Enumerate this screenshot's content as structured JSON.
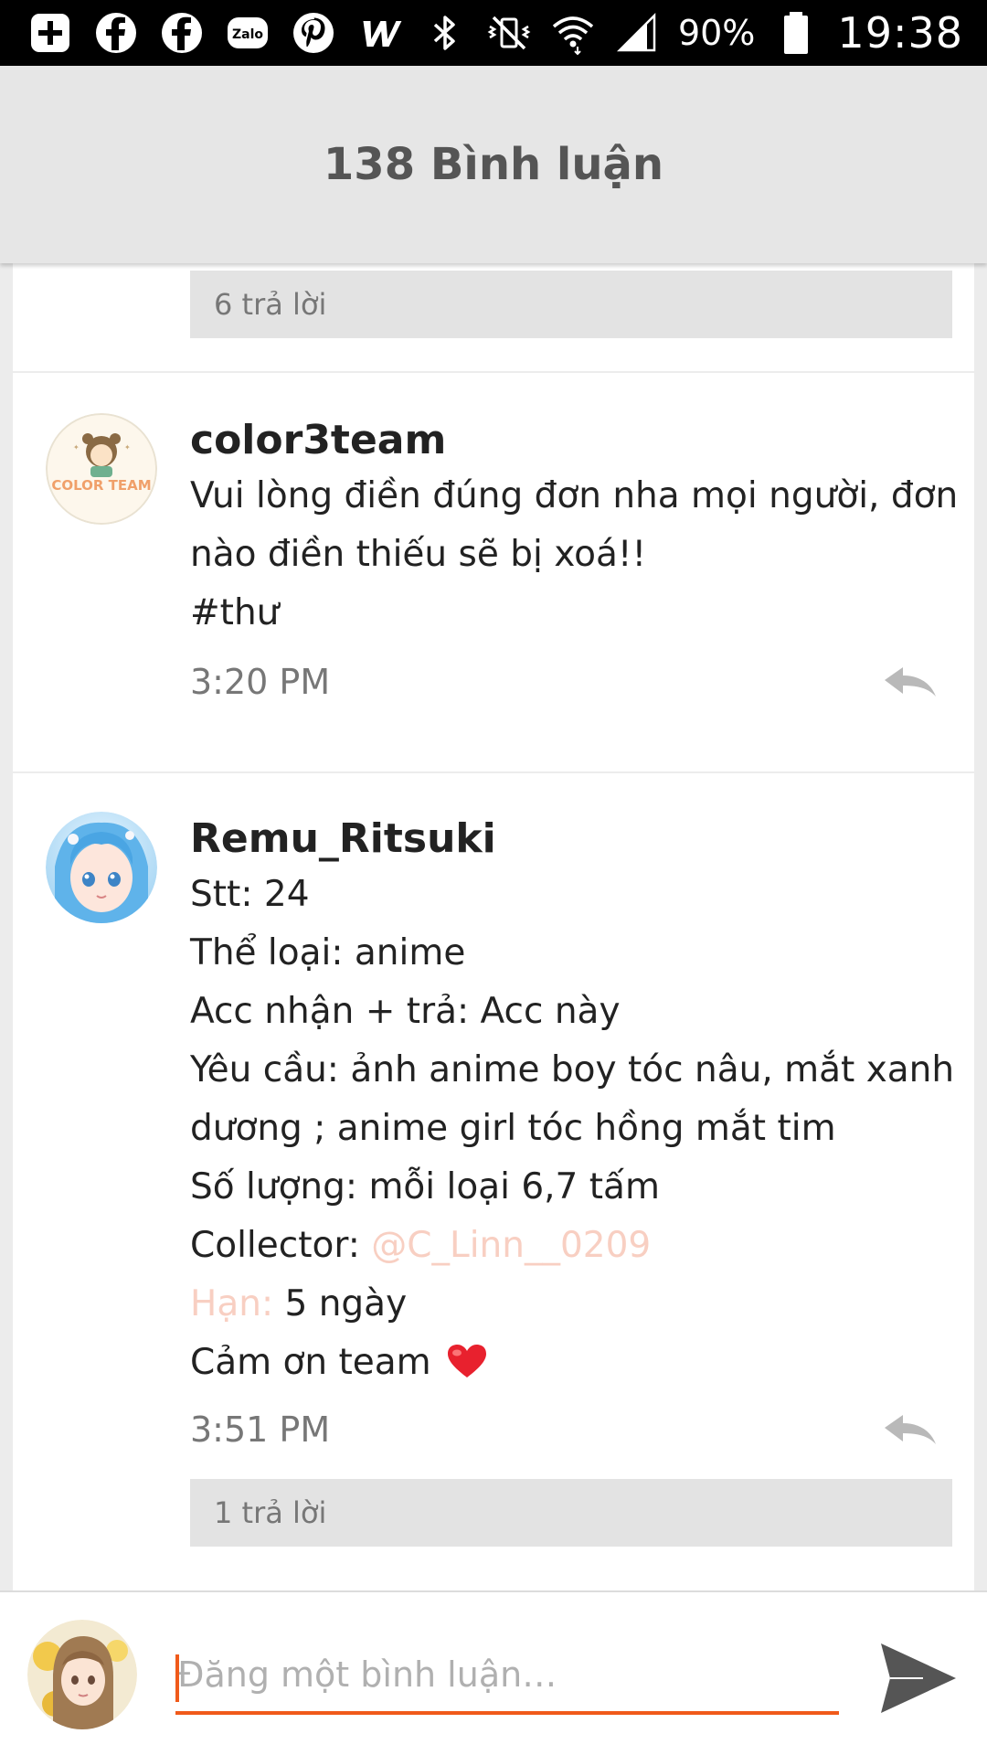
{
  "status_bar": {
    "left_icons": [
      "plus-box-icon",
      "facebook-icon",
      "facebook-icon",
      "zalo-icon",
      "pinterest-icon",
      "w-app-icon"
    ],
    "zalo_label": "Zalo",
    "battery": "90%",
    "time": "19:38"
  },
  "header": {
    "title": "138 Bình luận"
  },
  "top_reply_bar": {
    "label": "6 trả lời"
  },
  "comments": [
    {
      "username": "color3team",
      "avatar_text": "COLOR TEAM",
      "lines": [
        "Vui lòng điền đúng đơn nha mọi người, đơn",
        "nào điền thiếu sẽ bị xoá!!",
        "#thư"
      ],
      "time": "3:20 PM"
    },
    {
      "username": "Remu_Ritsuki",
      "lines": [
        "Stt: 24",
        "Thể loại: anime",
        "Acc nhận + trả: Acc này",
        "Yêu cầu: ảnh anime boy tóc nâu, mắt xanh",
        "dương ; anime girl tóc hồng mắt tim",
        "Số lượng: mỗi loại 6,7 tấm"
      ],
      "collector_label": "Collector: ",
      "collector_mention": "@C_Linn__0209",
      "deadline_label": "Hạn:",
      "deadline_value": " 5 ngày",
      "thanks": "Cảm ơn team",
      "time": "3:51 PM",
      "replies_label": "1 trả lời"
    }
  ],
  "composer": {
    "placeholder": "Đăng một bình luận…"
  },
  "colors": {
    "accent": "#f05a1a",
    "mention": "#f8cfc2",
    "header_bg": "#e6e6e6",
    "heart": "#e8212e"
  }
}
